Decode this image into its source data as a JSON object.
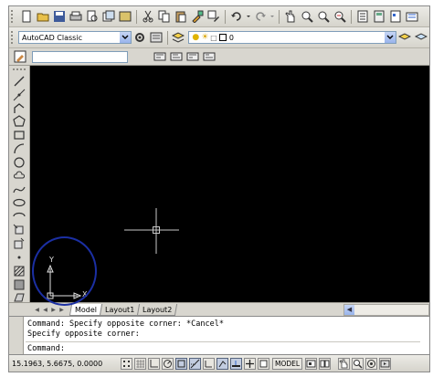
{
  "toolbar_standard": {
    "icons": [
      "new-icon",
      "open-icon",
      "save-icon",
      "plot-icon",
      "plot-preview-icon",
      "publish-icon",
      "3d-dwf-icon",
      "cut-icon",
      "copy-icon",
      "paste-icon",
      "match-properties-icon",
      "block-editor-icon",
      "undo-icon",
      "redo-icon",
      "pan-icon",
      "zoom-realtime-icon",
      "zoom-window-icon",
      "zoom-previous-icon",
      "properties-icon",
      "design-center-icon",
      "tool-palettes-icon",
      "sheet-set-icon"
    ]
  },
  "workspace": {
    "value": "AutoCAD Classic"
  },
  "layer": {
    "value": "0"
  },
  "command_line": {
    "line1": "Command: Specify opposite corner: *Cancel*",
    "line2": "Specify opposite corner:",
    "prompt": "Command:"
  },
  "layout_tabs": [
    "Model",
    "Layout1",
    "Layout2"
  ],
  "active_tab": "Model",
  "ucs": {
    "x_label": "X",
    "y_label": "Y"
  },
  "status_bar": {
    "coordinates": "15.1963, 5.6675, 0.0000",
    "model_label": "MODEL"
  },
  "colors": {
    "canvas": "#000000",
    "annotation_circle": "#1b2fa3",
    "crosshair": "#c8c8c8",
    "ucs_icon": "#e0e0e0"
  }
}
